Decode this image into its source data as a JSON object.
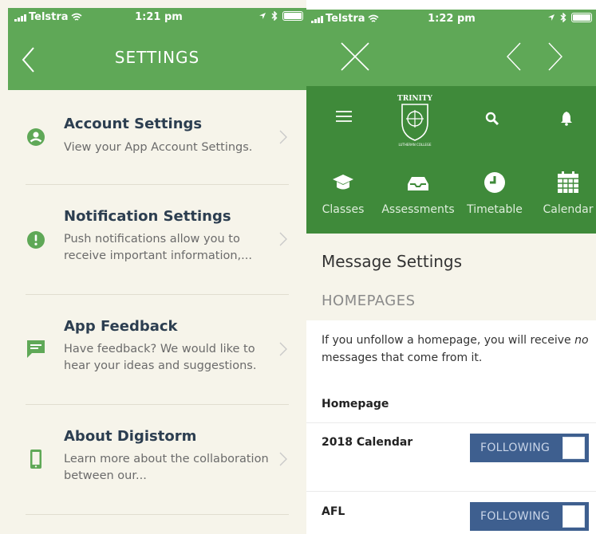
{
  "left": {
    "status": {
      "carrier": "Telstra",
      "time": "1:21 pm"
    },
    "header": {
      "title": "SETTINGS"
    },
    "items": [
      {
        "title": "Account Settings",
        "desc": "View your App Account Settings.",
        "icon": "account-icon"
      },
      {
        "title": "Notification Settings",
        "desc": "Push notifications allow you to receive important information,...",
        "icon": "alert-icon"
      },
      {
        "title": "App Feedback",
        "desc": "Have feedback? We would like to hear your ideas and suggestions.",
        "icon": "feedback-icon"
      },
      {
        "title": "About Digistorm",
        "desc": "Learn more about the collaboration between our...",
        "icon": "phone-icon"
      }
    ]
  },
  "right": {
    "status": {
      "carrier": "Telstra",
      "time": "1:22 pm"
    },
    "logo_text": "TRINITY",
    "logo_subtext": "LUTHERAN COLLEGE",
    "tabs": [
      {
        "label": "Classes",
        "icon": "graduation-cap-icon"
      },
      {
        "label": "Assessments",
        "icon": "inbox-icon"
      },
      {
        "label": "Timetable",
        "icon": "clock-icon"
      },
      {
        "label": "Calendar",
        "icon": "calendar-icon"
      }
    ],
    "heading": "Message Settings",
    "subheading": "HOMEPAGES",
    "info_before": "If you unfollow a homepage, you will receive ",
    "info_em": "no",
    "info_after": " messages that come from it.",
    "column_header": "Homepage",
    "rows": [
      {
        "label": "2018 Calendar",
        "state": "FOLLOWING"
      },
      {
        "label": "AFL",
        "state": "FOLLOWING"
      }
    ]
  },
  "colors": {
    "header_green": "#5fa857",
    "nav_green": "#3f8a3a",
    "background": "#f6f4ea",
    "toggle_blue": "#3e5f8f"
  }
}
